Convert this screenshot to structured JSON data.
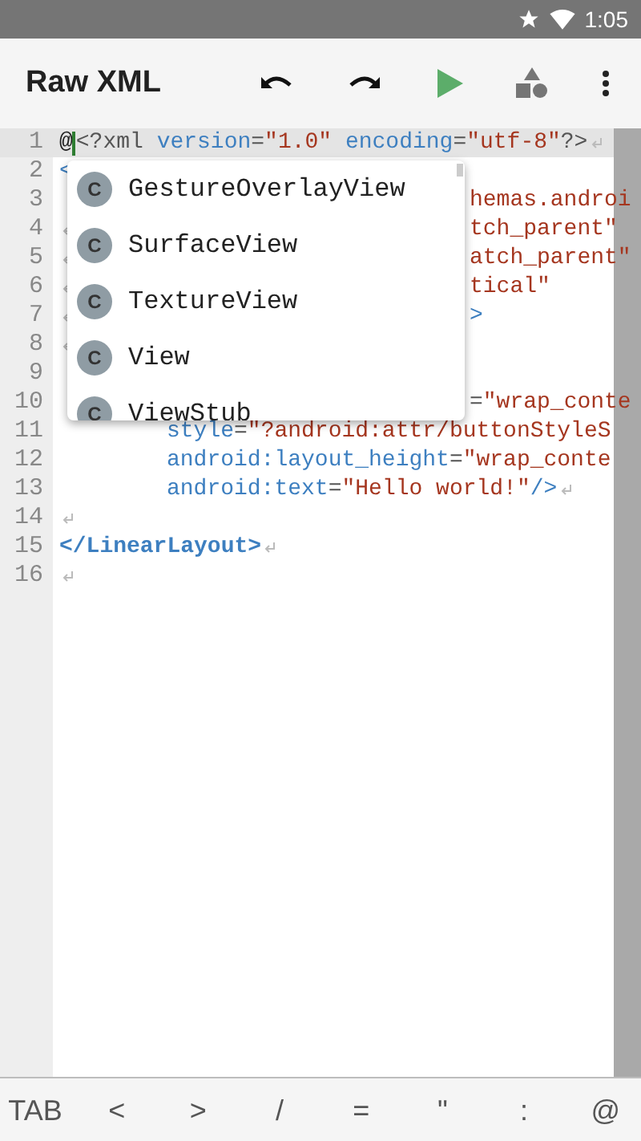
{
  "status_bar": {
    "time": "1:05"
  },
  "toolbar": {
    "title": "Raw XML"
  },
  "editor": {
    "lines": [
      {
        "number": "1",
        "current": true,
        "eol_mark": true,
        "left": [
          {
            "kind": "plain",
            "text": "@"
          },
          {
            "kind": "punct",
            "text": "<?xml"
          },
          {
            "kind": "attr",
            "text": " version"
          },
          {
            "kind": "punct",
            "text": "="
          },
          {
            "kind": "value",
            "text": "\"1.0\""
          },
          {
            "kind": "attr",
            "text": " encoding"
          },
          {
            "kind": "punct",
            "text": "="
          },
          {
            "kind": "value",
            "text": "\"utf-8\""
          },
          {
            "kind": "punct",
            "text": "?>"
          }
        ]
      },
      {
        "number": "2",
        "current": false,
        "eol_mark": false,
        "left": [
          {
            "kind": "tag",
            "text": "<"
          }
        ]
      },
      {
        "number": "3",
        "current": false,
        "eol_mark": false,
        "right": [
          {
            "kind": "value",
            "text": "hemas.androi"
          }
        ]
      },
      {
        "number": "4",
        "current": false,
        "eol_mark": true,
        "right": [
          {
            "kind": "value",
            "text": "tch_parent\""
          }
        ]
      },
      {
        "number": "5",
        "current": false,
        "eol_mark": true,
        "right": [
          {
            "kind": "value",
            "text": "atch_parent\""
          }
        ]
      },
      {
        "number": "6",
        "current": false,
        "eol_mark": true,
        "right": [
          {
            "kind": "value",
            "text": "tical\""
          }
        ]
      },
      {
        "number": "7",
        "current": false,
        "eol_mark": true,
        "right": [
          {
            "kind": "tag",
            "text": ">"
          }
        ]
      },
      {
        "number": "8",
        "current": false,
        "eol_mark": true
      },
      {
        "number": "9",
        "current": false,
        "eol_mark": false
      },
      {
        "number": "10",
        "current": false,
        "eol_mark": false,
        "right": [
          {
            "kind": "punct",
            "text": "="
          },
          {
            "kind": "value",
            "text": "\"wrap_conte"
          }
        ]
      },
      {
        "number": "11",
        "current": false,
        "eol_mark": false,
        "indented": true,
        "left": [
          {
            "kind": "attr",
            "text": "style"
          },
          {
            "kind": "punct",
            "text": "="
          },
          {
            "kind": "value",
            "text": "\"?android:attr/buttonStyleS"
          }
        ]
      },
      {
        "number": "12",
        "current": false,
        "eol_mark": false,
        "indented": true,
        "left": [
          {
            "kind": "attr",
            "text": "android:layout_height"
          },
          {
            "kind": "punct",
            "text": "="
          },
          {
            "kind": "value",
            "text": "\"wrap_conte"
          }
        ]
      },
      {
        "number": "13",
        "current": false,
        "eol_mark": true,
        "indented": true,
        "left": [
          {
            "kind": "attr",
            "text": "android:text"
          },
          {
            "kind": "punct",
            "text": "="
          },
          {
            "kind": "value",
            "text": "\"Hello world!\""
          },
          {
            "kind": "tag",
            "text": "/>"
          }
        ]
      },
      {
        "number": "14",
        "current": false,
        "eol_mark": true
      },
      {
        "number": "15",
        "current": false,
        "eol_mark": true,
        "left": [
          {
            "kind": "tag",
            "text": "</LinearLayout>"
          }
        ]
      },
      {
        "number": "16",
        "current": false,
        "eol_mark": true
      }
    ]
  },
  "completion": {
    "items": [
      {
        "badge": "C",
        "label": "GestureOverlayView"
      },
      {
        "badge": "C",
        "label": "SurfaceView"
      },
      {
        "badge": "C",
        "label": "TextureView"
      },
      {
        "badge": "C",
        "label": "View"
      },
      {
        "badge": "C",
        "label": "ViewStub"
      }
    ]
  },
  "symbol_bar": {
    "keys": [
      "TAB",
      "<",
      ">",
      "/",
      "=",
      "\"",
      ":",
      "@"
    ]
  }
}
